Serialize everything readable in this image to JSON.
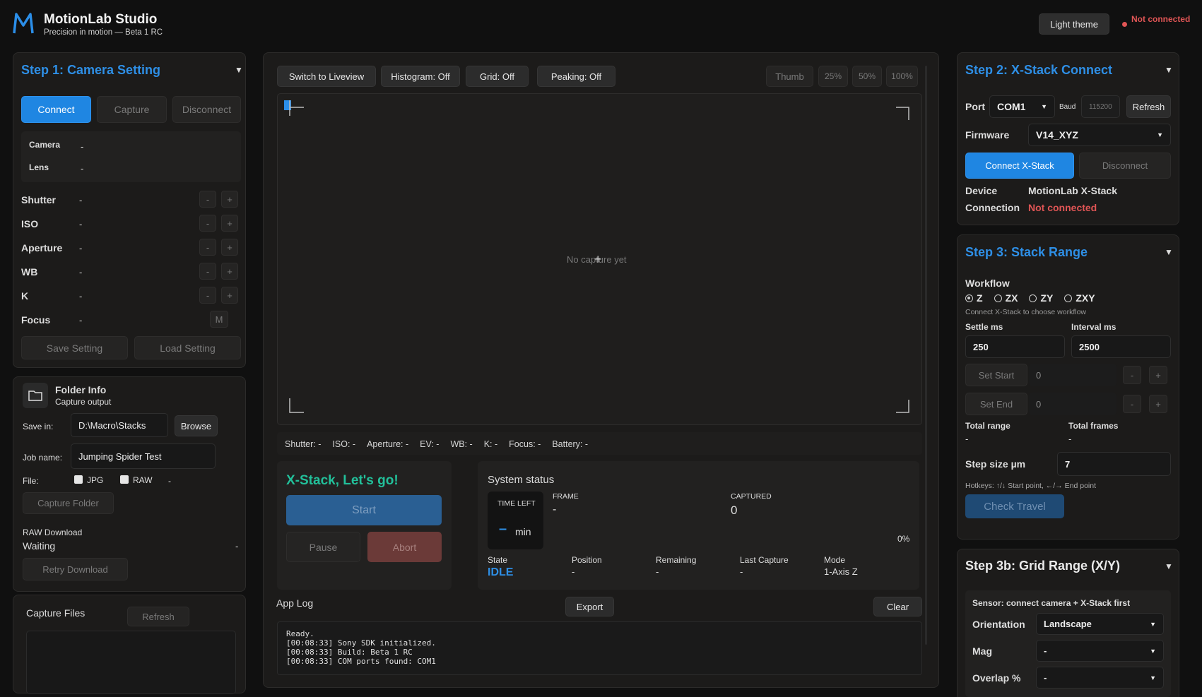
{
  "app": {
    "logo_letter": "M",
    "title": "MotionLab Studio",
    "subtitle": "Precision in motion — Beta 1 RC",
    "theme_button": "Light theme",
    "connection_status": "Not connected",
    "status_color": "#e05555",
    "accent": "#1f86e2"
  },
  "camera": {
    "title": "Step 1: Camera Setting",
    "connect": "Connect",
    "capture": "Capture",
    "disconnect": "Disconnect",
    "info": [
      {
        "label": "Camera",
        "value": "-"
      },
      {
        "label": "Lens",
        "value": "-"
      }
    ],
    "settings": [
      {
        "label": "Shutter",
        "value": "-",
        "minus": "-",
        "plus": "+"
      },
      {
        "label": "ISO",
        "value": "-",
        "minus": "-",
        "plus": "+"
      },
      {
        "label": "Aperture",
        "value": "-",
        "minus": "-",
        "plus": "+"
      },
      {
        "label": "WB",
        "value": "-",
        "minus": "-",
        "plus": "+"
      },
      {
        "label": "K",
        "value": "-",
        "minus": "-",
        "plus": "+"
      }
    ],
    "focus": {
      "label": "Focus",
      "value": "-",
      "mode": "M"
    },
    "save": "Save Setting",
    "load": "Load Setting"
  },
  "folder": {
    "title": "Folder Info",
    "subtitle": "Capture output",
    "save_in_label": "Save in:",
    "save_in": "D:\\Macro\\Stacks",
    "browse": "Browse",
    "job_label": "Job name:",
    "job": "Jumping Spider Test",
    "file_label": "File:",
    "jpg": "JPG",
    "raw": "RAW",
    "file_dash": "-",
    "capture_folder": "Capture Folder",
    "raw_download_label": "RAW Download",
    "raw_download_status": "Waiting",
    "raw_download_value": "-",
    "retry": "Retry Download"
  },
  "capture_files": {
    "title": "Capture Files",
    "refresh": "Refresh"
  },
  "toolbar": {
    "liveview": "Switch to Liveview",
    "histogram": "Histogram: Off",
    "grid": "Grid: Off",
    "peaking": "Peaking: Off",
    "thumb": "Thumb",
    "z25": "25%",
    "z50": "50%",
    "z100": "100%"
  },
  "preview": {
    "empty": "No capture yet"
  },
  "statusbar": [
    "Shutter: -",
    "ISO: -",
    "Aperture: -",
    "EV: -",
    "WB: -",
    "K: -",
    "Focus: -",
    "Battery: -"
  ],
  "run": {
    "title": "X-Stack, Let's go!",
    "start": "Start",
    "pause": "Pause",
    "abort": "Abort"
  },
  "system": {
    "title": "System status",
    "time_left_label": "TIME LEFT",
    "time_left_value": "–",
    "time_left_unit": "min",
    "frame_label": "FRAME",
    "frame_value": "-",
    "captured_label": "CAPTURED",
    "captured_value": "0",
    "progress": "0%",
    "progress_fraction": 0,
    "fields": [
      {
        "label": "State",
        "value": "IDLE"
      },
      {
        "label": "Position",
        "value": "-"
      },
      {
        "label": "Remaining",
        "value": "-"
      },
      {
        "label": "Last Capture",
        "value": "-"
      },
      {
        "label": "Mode",
        "value": "1-Axis Z"
      }
    ]
  },
  "log": {
    "title": "App Log",
    "export": "Export",
    "clear": "Clear",
    "lines": [
      "Ready.",
      "[00:08:33] Sony SDK initialized.",
      "[00:08:33] Build: Beta 1 RC",
      "[00:08:33] COM ports found: COM1"
    ]
  },
  "xstack": {
    "title": "Step 2: X-Stack Connect",
    "port_label": "Port",
    "port": "COM1",
    "baud_label": "Baud",
    "baud": "115200",
    "refresh": "Refresh",
    "firmware_label": "Firmware",
    "firmware": "V14_XYZ",
    "connect": "Connect X-Stack",
    "disconnect": "Disconnect",
    "device_label": "Device",
    "device": "MotionLab X-Stack",
    "connection_label": "Connection",
    "connection": "Not connected"
  },
  "range": {
    "title": "Step 3: Stack Range",
    "workflow_label": "Workflow",
    "options": [
      "Z",
      "ZX",
      "ZY",
      "ZXY"
    ],
    "hint": "Connect X-Stack to choose workflow",
    "settle_label": "Settle ms",
    "settle": "250",
    "interval_label": "Interval ms",
    "interval": "2500",
    "set_start": "Set Start",
    "start_val": "0",
    "set_end": "Set End",
    "end_val": "0",
    "minus": "-",
    "plus": "+",
    "total_range_label": "Total range",
    "total_range": "-",
    "total_frames_label": "Total frames",
    "total_frames": "-",
    "step_label": "Step size µm",
    "step": "7",
    "hotkeys": "Hotkeys: ↑/↓ Start point, ←/→ End point",
    "check": "Check Travel"
  },
  "grid": {
    "title": "Step 3b: Grid Range (X/Y)",
    "sensor": "Sensor: connect camera + X-Stack first",
    "orientation_label": "Orientation",
    "orientation": "Landscape",
    "mag_label": "Mag",
    "mag": "-",
    "overlap_label": "Overlap %",
    "overlap": "-"
  }
}
